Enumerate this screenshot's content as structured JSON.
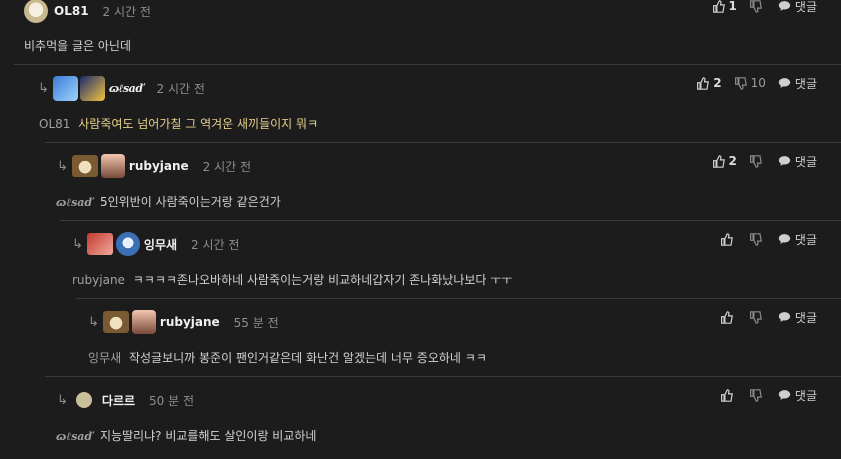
{
  "reply_label": "댓글",
  "comments": [
    {
      "nick": "OL81",
      "time": "2 시간 전",
      "up": "1",
      "down": "",
      "mention": "",
      "text": "비추먹을 글은 아닌데"
    },
    {
      "nick": "ɷℓsaď",
      "time": "2 시간 전",
      "up": "2",
      "down": "10",
      "mention": "OL81",
      "text": "사람죽여도 넘어가칠 그 역겨운 새끼들이지 뭐ㅋ"
    },
    {
      "nick": "rubyjane",
      "time": "2 시간 전",
      "up": "2",
      "down": "",
      "mention": "ɷℓsaď",
      "text": "5인위반이 사람죽이는거랑 같은건가"
    },
    {
      "nick": "잉무새",
      "time": "2 시간 전",
      "up": "",
      "down": "",
      "mention": "rubyjane",
      "text": "ㅋㅋㅋㅋ존나오바하네 사람죽이는거랑 비교하네갑자기 존나화났나보다 ㅜㅜ"
    },
    {
      "nick": "rubyjane",
      "time": "55 분 전",
      "up": "",
      "down": "",
      "mention": "잉무새",
      "text": "작성글보니까 봉준이 팬인거같은데 화난건 알겠는데 너무 증오하네 ㅋㅋ"
    },
    {
      "nick": "다르르",
      "time": "50 분 전",
      "up": "",
      "down": "",
      "mention": "ɷℓsaď",
      "text": "지능딸리냐? 비교를해도 살인이랑 비교하네"
    }
  ],
  "icons": {
    "up": "thumbs-up-icon",
    "down": "thumbs-down-icon",
    "reply": "speech-bubble-icon",
    "arrow": "reply-arrow-icon"
  },
  "colors": {
    "background": "#1c1c1c",
    "text": "#d6d6d6",
    "muted": "#8e8e8e",
    "separator": "#3a3a3a"
  }
}
